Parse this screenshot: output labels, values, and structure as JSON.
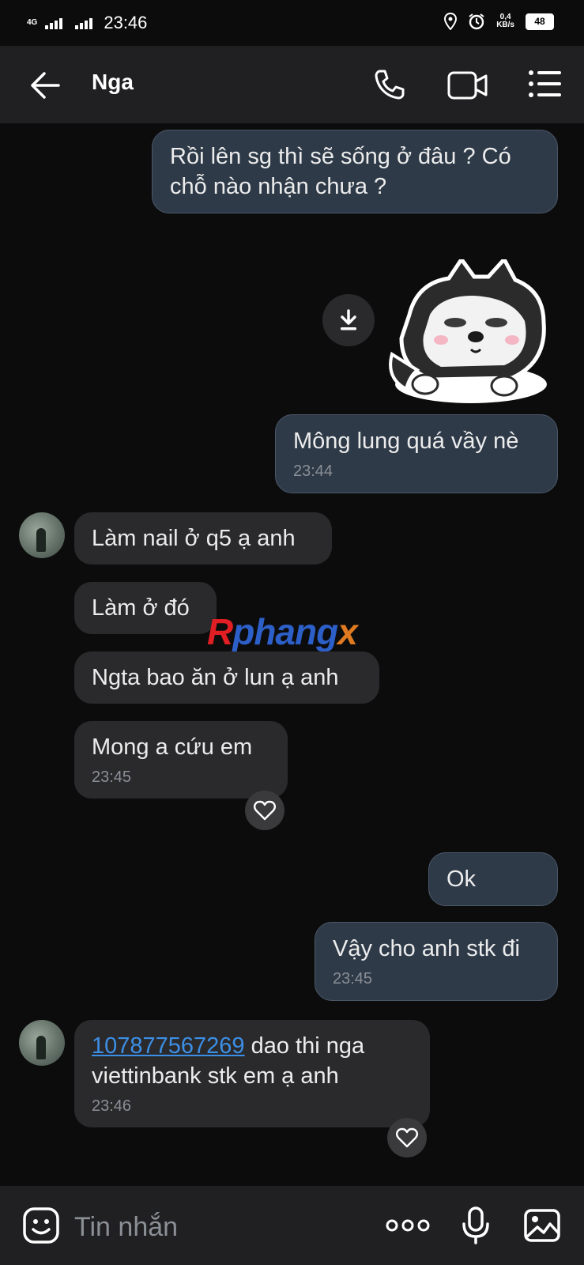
{
  "status_bar": {
    "network": "4G",
    "time": "23:46",
    "net_speed_value": "0,4",
    "net_speed_unit": "KB/s",
    "battery": "48"
  },
  "header": {
    "title": "Nga",
    "icons": [
      "back-arrow-icon",
      "phone-icon",
      "video-call-icon",
      "menu-icon"
    ]
  },
  "messages": [
    {
      "dir": "out",
      "text": "Rồi lên sg thì sẽ sống ở đâu ? Có chỗ nào nhận chưa ?"
    },
    {
      "dir": "out",
      "type": "sticker",
      "sticker": "husky-dog-sticker"
    },
    {
      "dir": "out",
      "text": "Mông lung quá vầy nè",
      "time": "23:44"
    },
    {
      "dir": "in",
      "text": "Làm nail ở q5 ạ anh"
    },
    {
      "dir": "in",
      "text": "Làm ở đó"
    },
    {
      "dir": "in",
      "text": "Ngta bao ăn ở lun ạ anh"
    },
    {
      "dir": "in",
      "text": "Mong a cứu em",
      "time": "23:45"
    },
    {
      "dir": "out",
      "text": "Ok"
    },
    {
      "dir": "out",
      "text": "Vậy cho anh stk đi",
      "time": "23:45"
    },
    {
      "dir": "in",
      "link": "107877567269",
      "text_after_link": " dao thi nga",
      "text_line2": "viettinbank stk em ạ anh",
      "time": "23:46"
    }
  ],
  "watermark": {
    "part1": "R",
    "part2": "phang",
    "part3": "x"
  },
  "composer": {
    "placeholder": "Tin nhắn"
  },
  "colors": {
    "background": "#0c0c0d",
    "outgoing_bubble": "#2e3a48",
    "incoming_bubble": "#2a2a2c",
    "link": "#3c8fe6"
  }
}
